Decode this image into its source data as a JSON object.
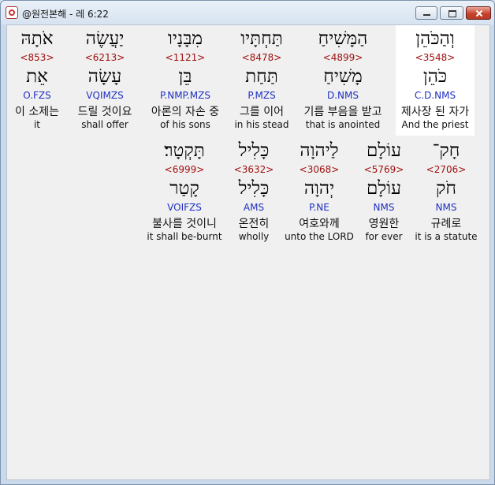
{
  "window": {
    "title": "@원전본해 - 레 6:22"
  },
  "words": [
    {
      "heb": "וְהַכֹּהֵן",
      "strong": "<3548>",
      "root": "כֹּהֵן",
      "parse": "C.D.NMS",
      "ko": "제사장 된 자가",
      "en": "And the priest"
    },
    {
      "heb": "הַמָּשִׁיחַ",
      "strong": "<4899>",
      "root": "מָשִׁיחַ",
      "parse": "D.NMS",
      "ko": "기름 부음을 받고",
      "en": "that is anointed"
    },
    {
      "heb": "תַּחְתָּיו",
      "strong": "<8478>",
      "root": "תַּחַת",
      "parse": "P.MZS",
      "ko": "그를 이어",
      "en": "in his stead"
    },
    {
      "heb": "מִבָּנָיו",
      "strong": "<1121>",
      "root": "בֵּן",
      "parse": "P.NMP.MZS",
      "ko": "아론의 자손 중",
      "en": "of his sons"
    },
    {
      "heb": "יַעֲשֶׂה",
      "strong": "<6213>",
      "root": "עָשָׂה",
      "parse": "VQIMZS",
      "ko": "드릴 것이요",
      "en": "shall offer"
    },
    {
      "heb": "אֹתָהּ",
      "strong": "<853>",
      "root": "אֵת",
      "parse": "O.FZS",
      "ko": "이 소제는",
      "en": "it"
    },
    {
      "heb": "חָק־",
      "strong": "<2706>",
      "root": "חֹק",
      "parse": "NMS",
      "ko": "규례로",
      "en": "it is a statute"
    },
    {
      "heb": "עוֹלָם",
      "strong": "<5769>",
      "root": "עוֹלָם",
      "parse": "NMS",
      "ko": "영원한",
      "en": "for ever"
    },
    {
      "heb": "לַיהוָה",
      "strong": "<3068>",
      "root": "יְהוָה",
      "parse": "P.NE",
      "ko": "여호와께",
      "en": "unto the LORD"
    },
    {
      "heb": "כָּלִיל",
      "strong": "<3632>",
      "root": "כָּלִיל",
      "parse": "AMS",
      "ko": "온전히",
      "en": "wholly"
    },
    {
      "heb": "תָּקְטָר׃",
      "strong": "<6999>",
      "root": "קָטַר",
      "parse": "VOIFZS",
      "ko": "불사를 것이니",
      "en": "it shall be-burnt"
    }
  ]
}
